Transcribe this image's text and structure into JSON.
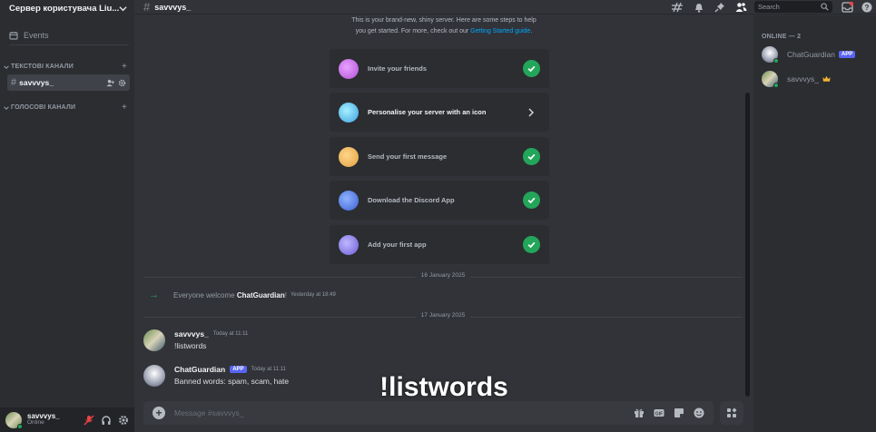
{
  "server": {
    "name": "Сервер користувача Liu..."
  },
  "sidebar": {
    "events_label": "Events",
    "categories": [
      {
        "label": "ТЕКСТОВІ КАНАЛИ"
      },
      {
        "label": "ГОЛОСОВІ КАНАЛИ"
      }
    ],
    "channels": [
      {
        "name": "savvvys_"
      }
    ]
  },
  "user": {
    "name": "savvvys_",
    "status": "Online"
  },
  "topbar": {
    "channel_name": "savvvys_",
    "search_placeholder": "Search"
  },
  "intro": {
    "line1": "This is your brand-new, shiny server. Here are some steps to help",
    "line2": "you get started. For more, check out our",
    "link": "Getting Started guide",
    "link_suffix": "."
  },
  "steps": [
    {
      "label": "Invite your friends",
      "done": true
    },
    {
      "label": "Personalise your server with an icon",
      "done": false
    },
    {
      "label": "Send your first message",
      "done": true
    },
    {
      "label": "Download the Discord App",
      "done": true
    },
    {
      "label": "Add your first app",
      "done": true
    }
  ],
  "dates": [
    "16 January 2025",
    "17 January 2025"
  ],
  "system_message": {
    "prefix": "Everyone welcome",
    "name": "ChatGuardian",
    "suffix": "!",
    "time": "Yesterday at 18:49"
  },
  "messages": [
    {
      "author": "savvvys_",
      "time": "Today at 11:11",
      "text": "!listwords",
      "app": false
    },
    {
      "author": "ChatGuardian",
      "badge": "APP",
      "time": "Today at 11:11",
      "text": "Banned words: spam, scam, hate",
      "app": true
    }
  ],
  "overlay_text": "!listwords",
  "composer": {
    "placeholder": "Message #savvvys_"
  },
  "members": {
    "header": "ONLINE — 2",
    "list": [
      {
        "name": "ChatGuardian",
        "badge": "APP"
      },
      {
        "name": "savvvys_",
        "owner": true
      }
    ]
  },
  "colors": {
    "accent": "#5865f2",
    "online": "#23a55a",
    "link": "#00a8fc"
  }
}
